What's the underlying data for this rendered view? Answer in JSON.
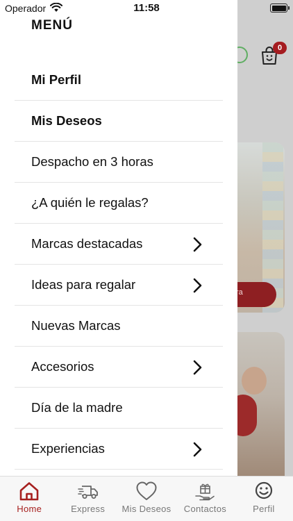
{
  "status_bar": {
    "carrier": "Operador",
    "time": "11:58"
  },
  "menu": {
    "title": "MENÚ",
    "items": [
      {
        "label": "Mi Perfil",
        "bold": true,
        "chevron": false
      },
      {
        "label": "Mis Deseos",
        "bold": true,
        "chevron": false
      },
      {
        "label": "Despacho en 3 horas",
        "bold": false,
        "chevron": false
      },
      {
        "label": "¿A quién le regalas?",
        "bold": false,
        "chevron": false
      },
      {
        "label": "Marcas destacadas",
        "bold": false,
        "chevron": true
      },
      {
        "label": "Ideas para regalar",
        "bold": false,
        "chevron": true
      },
      {
        "label": "Nuevas Marcas",
        "bold": false,
        "chevron": false
      },
      {
        "label": "Accesorios",
        "bold": false,
        "chevron": true
      },
      {
        "label": "Día de la madre",
        "bold": false,
        "chevron": false
      },
      {
        "label": "Experiencias",
        "bold": false,
        "chevron": true
      }
    ]
  },
  "background": {
    "cart_count": "0",
    "banner_button_fragment": "ra"
  },
  "tab_bar": {
    "active_color": "#a6201f",
    "inactive_color": "#777777",
    "tabs": [
      {
        "label": "Home",
        "icon": "home-icon",
        "active": true
      },
      {
        "label": "Express",
        "icon": "truck-icon",
        "active": false
      },
      {
        "label": "Mis Deseos",
        "icon": "heart-icon",
        "active": false
      },
      {
        "label": "Contactos",
        "icon": "gift-hand-icon",
        "active": false
      },
      {
        "label": "Perfil",
        "icon": "smiley-icon",
        "active": false
      }
    ]
  }
}
